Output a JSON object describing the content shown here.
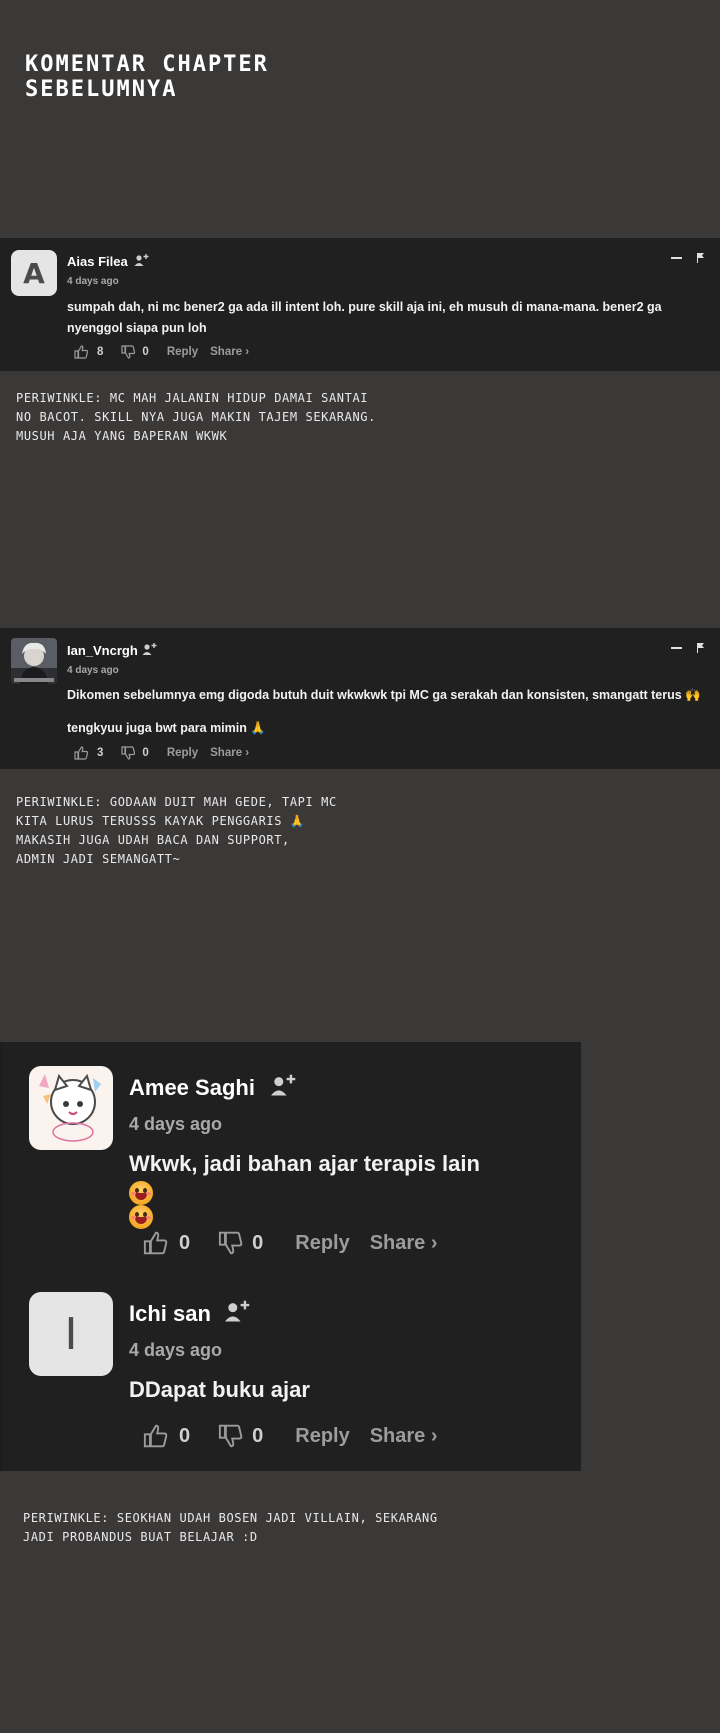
{
  "title": {
    "line1": "Komentar Chapter",
    "line2": "Sebelumnya"
  },
  "comments": [
    {
      "avatar_letter": "A",
      "username": "Aias Filea",
      "time": "4 days ago",
      "body": [
        "sumpah dah, ni mc bener2 ga ada ill intent loh. pure skill aja ini, eh musuh di mana-mana. bener2 ga",
        "nyenggol siapa pun loh"
      ],
      "likes": "8",
      "dislikes": "0",
      "reply_label": "Reply",
      "share_label": "Share ›"
    },
    {
      "username": "Ian_Vncrgh",
      "time": "4 days ago",
      "body": [
        "Dikomen sebelumnya emg digoda butuh duit wkwkwk tpi MC ga serakah dan konsisten, smangatt terus 🙌",
        "tengkyuu juga bwt para mimin 🙏"
      ],
      "likes": "3",
      "dislikes": "0",
      "reply_label": "Reply",
      "share_label": "Share ›"
    }
  ],
  "replies": [
    [
      "Periwinkle: MC mah jalanin hidup damai santai",
      "no bacot. Skill nya juga makin tajem sekarang.",
      "Musuh aja yang baperan wkwk"
    ],
    [
      "Periwinkle: Godaan duit mah gede, tapi MC",
      "kita lurus terusss kayak penggaris 🙏",
      "Makasih juga udah baca dan support,",
      "admin jadi semangatt~"
    ],
    [
      "Periwinkle: Seokhan udah bosen jadi villain, sekarang",
      "jadi probandus buat belajar :D"
    ]
  ],
  "thread": [
    {
      "username": "Amee Saghi",
      "time": "4 days ago",
      "body": "Wkwk, jadi bahan ajar terapis lain",
      "likes": "0",
      "dislikes": "0",
      "reply_label": "Reply",
      "share_label": "Share ›"
    },
    {
      "avatar_letter": "I",
      "username": "Ichi san",
      "time": "4 days ago",
      "body": "DDapat buku ajar",
      "likes": "0",
      "dislikes": "0",
      "reply_label": "Reply",
      "share_label": "Share ›"
    }
  ],
  "icons": {
    "follow": "add-user-icon",
    "like": "thumbs-up-icon",
    "dislike": "thumbs-down-icon",
    "collapse": "minus-icon",
    "flag": "flag-icon"
  },
  "colors": {
    "page_bg": "#3b3838",
    "card_bg": "#202020",
    "text": "#f2f2f2",
    "muted": "#9c9c9c"
  }
}
